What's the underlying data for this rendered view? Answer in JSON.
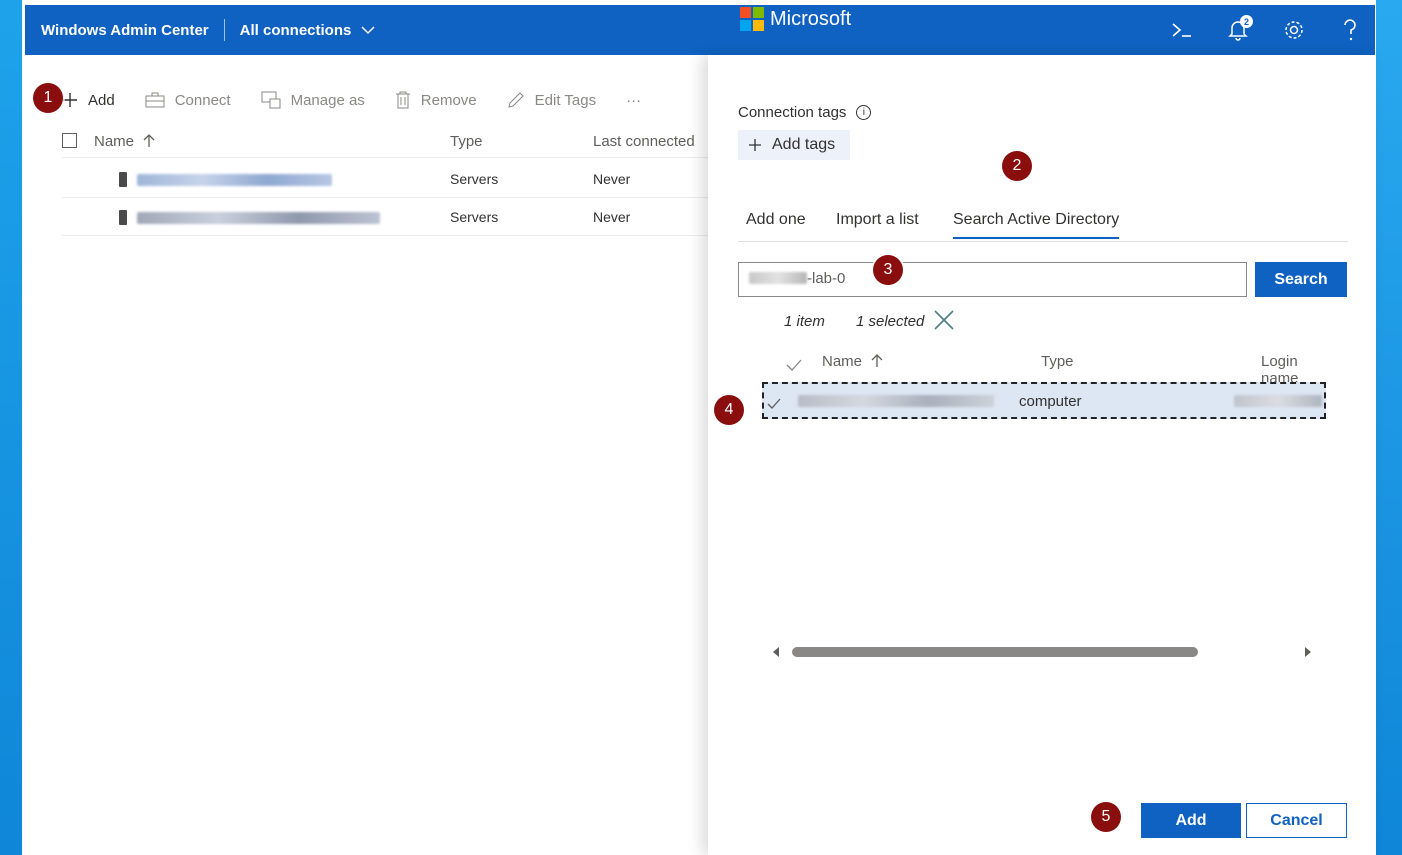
{
  "header": {
    "app_title": "Windows Admin Center",
    "connections_label": "All connections",
    "brand": "Microsoft",
    "notification_count": "2"
  },
  "toolbar": {
    "add": "Add",
    "connect": "Connect",
    "manage_as": "Manage as",
    "remove": "Remove",
    "edit_tags": "Edit Tags",
    "more": "···"
  },
  "connections_table": {
    "columns": [
      "Name",
      "Type",
      "Last connected"
    ],
    "rows": [
      {
        "type": "Servers",
        "last_connected": "Never"
      },
      {
        "type": "Servers",
        "last_connected": "Never"
      }
    ]
  },
  "panel": {
    "connection_tags_label": "Connection tags",
    "add_tags_label": "Add tags",
    "tabs": [
      "Add one",
      "Import a list",
      "Search Active Directory"
    ],
    "search_value_suffix": "-lab-0",
    "search_button": "Search",
    "item_count": "1 item",
    "selected_count": "1 selected",
    "results_columns": [
      "Name",
      "Type",
      "Login name"
    ],
    "result_row": {
      "type": "computer"
    },
    "add_button": "Add",
    "cancel_button": "Cancel"
  },
  "steps": [
    "1",
    "2",
    "3",
    "4",
    "5"
  ],
  "colors": {
    "accent": "#0f62c2",
    "step_marker": "#8b0e0e",
    "selected_row": "#dde6f3"
  }
}
